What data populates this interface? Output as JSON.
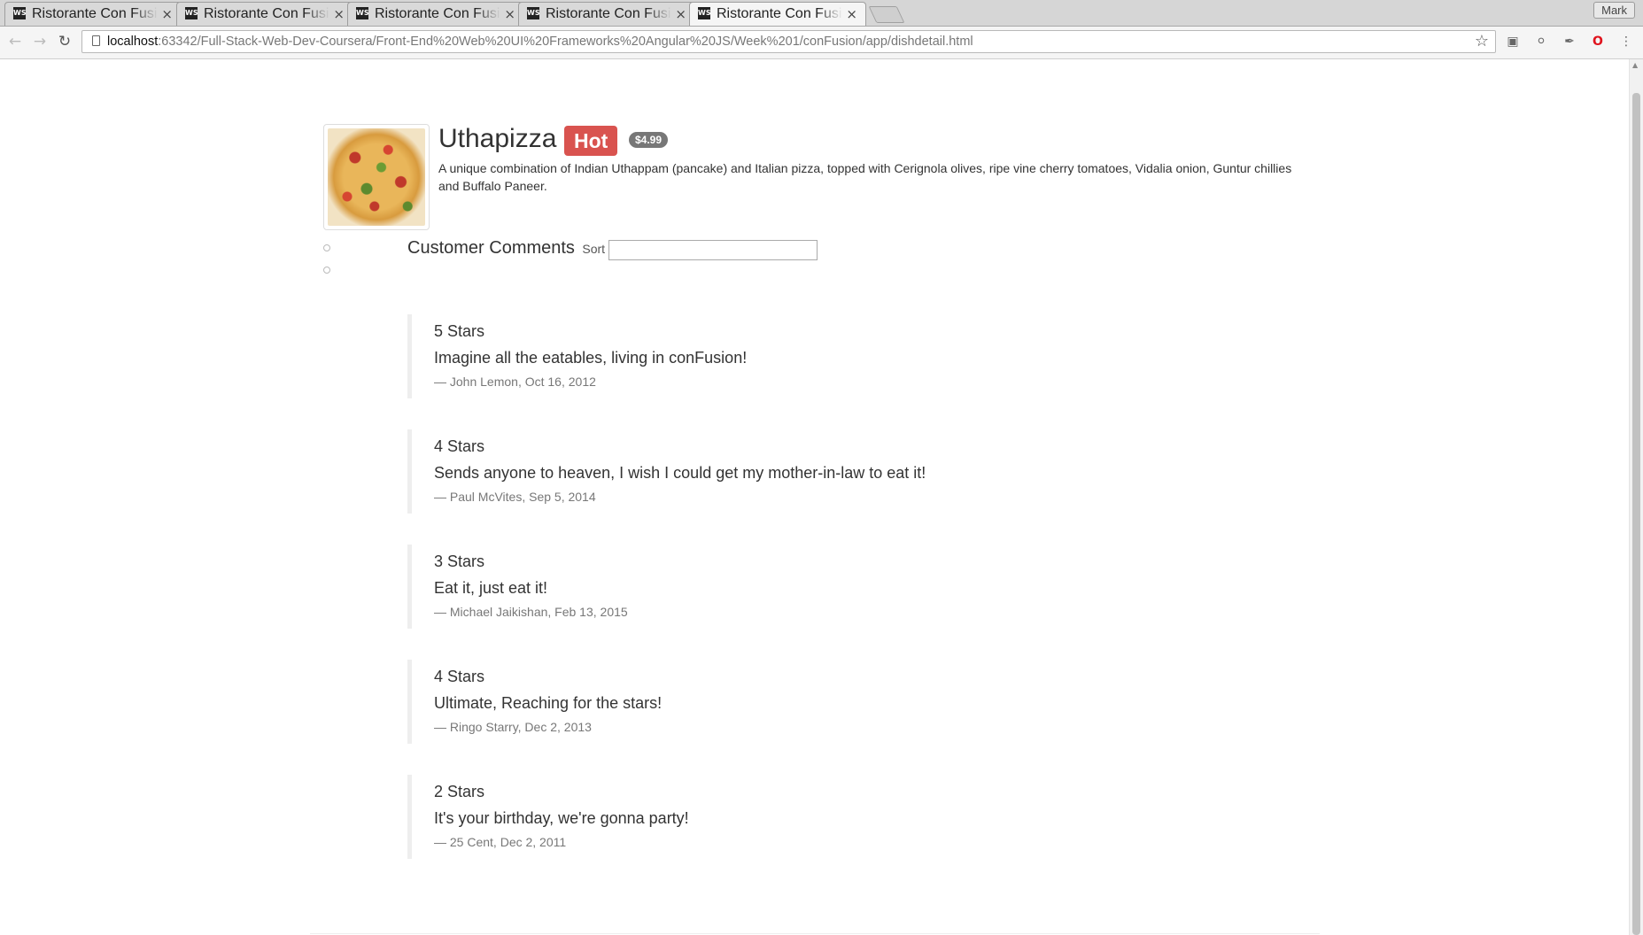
{
  "browser": {
    "tabs": [
      {
        "title": "Ristorante Con Fusion"
      },
      {
        "title": "Ristorante Con Fusion"
      },
      {
        "title": "Ristorante Con Fusion"
      },
      {
        "title": "Ristorante Con Fusion"
      },
      {
        "title": "Ristorante Con Fusion"
      }
    ],
    "tab_favicon": "WS",
    "tab_close": "×",
    "profile_name": "Mark",
    "url_host": "localhost",
    "url_rest": ":63342/Full-Stack-Web-Dev-Coursera/Front-End%20Web%20UI%20Frameworks%20Angular%20JS/Week%201/conFusion/app/dishdetail.html",
    "icons": [
      "back-arrow-icon",
      "forward-arrow-icon",
      "reload-icon",
      "page-icon",
      "bookmark-star-icon",
      "extension-icons"
    ]
  },
  "dish": {
    "name": "Uthapizza",
    "label": "Hot",
    "price": "$4.99",
    "description": "A unique combination of Indian Uthappam (pancake) and Italian pizza, topped with Cerignola olives, ripe vine cherry tomatoes, Vidalia onion, Guntur chillies and Buffalo Paneer."
  },
  "comments_section": {
    "title": "Customer Comments",
    "sort_label": "Sort by:",
    "sort_value": ""
  },
  "comments": [
    {
      "rating": "5 Stars",
      "text": "Imagine all the eatables, living in conFusion!",
      "meta": "— John Lemon, Oct 16, 2012"
    },
    {
      "rating": "4 Stars",
      "text": "Sends anyone to heaven, I wish I could get my mother-in-law to eat it!",
      "meta": "— Paul McVites, Sep 5, 2014"
    },
    {
      "rating": "3 Stars",
      "text": "Eat it, just eat it!",
      "meta": "— Michael Jaikishan, Feb 13, 2015"
    },
    {
      "rating": "4 Stars",
      "text": "Ultimate, Reaching for the stars!",
      "meta": "— Ringo Starry, Dec 2, 2013"
    },
    {
      "rating": "2 Stars",
      "text": "It's your birthday, we're gonna party!",
      "meta": "— 25 Cent, Dec 2, 2011"
    }
  ],
  "colors": {
    "hot_badge": "#d9534f",
    "price_badge": "#777777",
    "comment_border": "#eeeeee"
  }
}
